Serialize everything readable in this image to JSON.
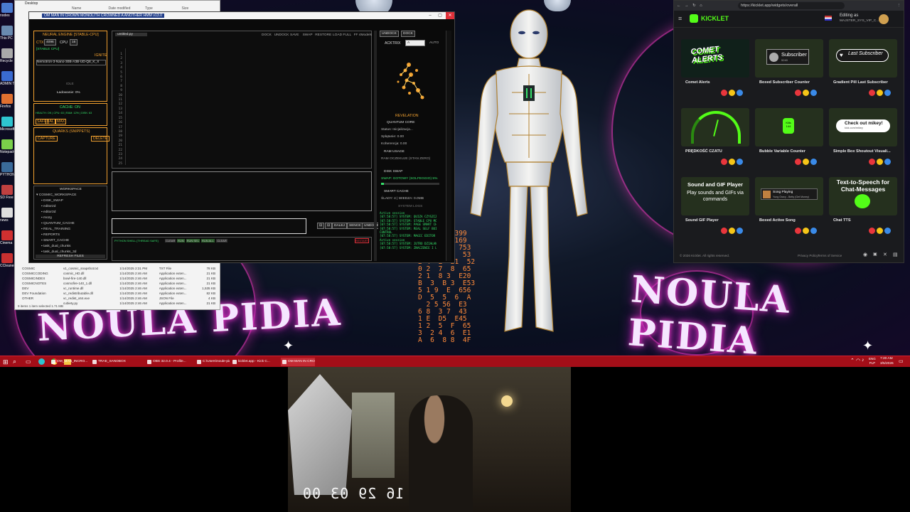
{
  "colors": {
    "accent_orange": "#f0a030",
    "terminal_green": "#35e06a",
    "taskbar": "#a30e18",
    "kicklet_green": "#53fc18"
  },
  "desktop": {
    "icons": [
      "nodes",
      "This PC",
      "Recycle",
      "ADMIN TOOLS",
      "Firefox",
      "Microsoft Edge",
      "Notepad++",
      "PYTHON",
      "SD Free",
      "news",
      "Cinema",
      "CCleaner"
    ],
    "wallpaper_text_left": "NOULA PIDIA",
    "wallpaper_text_right": "NOULA PIDIA",
    "hex_columns": [
      "4f6B7",
      "0L5 2",
      "6 5 9",
      "13 C20",
      "0A3B 8",
      "E5 93",
      "G2 7",
      "8 E99 4",
      "F1 A30",
      "3 4B 2",
      "5E8 69",
      "20 E1 4",
      "89 D5 8",
      "6A9 0 30",
      "E67 9 2",
      "15C 43"
    ],
    "hex_lines": [
      "658 B  82399",
      "E18 A  38169",
      "3 T  7 E  753",
      "7 3  B  3  53",
      "2 4  E  21  52",
      "0 2  7  8  65",
      "2 1  8 3  E20",
      "B  3  B 3  E53",
      "5 1 9  E  656",
      "D  5  5  6  A",
      "  2 5 56  E3",
      "6 8  3 7  43",
      "1 E  D5  E45",
      "1 2  5  F  65",
      "3  2 4  6  E1",
      "A  6  8 8  4F"
    ]
  },
  "explorer": {
    "title": "Desktop",
    "columns": [
      "Name",
      "Date modified",
      "Type",
      "Size"
    ],
    "tree": [
      "COSMIC",
      "COSMICCODING",
      "COSMICINDEX",
      "COSMICNOTES",
      "DEV",
      "DEV Foundation",
      "OTHER"
    ],
    "files": [
      {
        "name": "v1_cosmic_snapshot.txt",
        "date": "1/14/2025 2:31 PM",
        "type": "TXT File",
        "size": "78 KB"
      },
      {
        "name": "cosmic_HD.dll",
        "date": "1/14/2025 2:46 AM",
        "type": "Application exten...",
        "size": "21 KB"
      },
      {
        "name": "bowl-fire-140.dll",
        "date": "1/14/2025 2:46 AM",
        "type": "Application exten...",
        "size": "21 KB"
      },
      {
        "name": "cosmofire-140_1.dll",
        "date": "1/14/2025 2:46 AM",
        "type": "Application exten...",
        "size": "21 KB"
      },
      {
        "name": "vc_runtime.dll",
        "date": "1/14/2025 2:46 AM",
        "type": "Application exten...",
        "size": "1,535 KB"
      },
      {
        "name": "vc_redistributable.dll",
        "date": "1/14/2025 2:46 AM",
        "type": "Application exten...",
        "size": "82 KB"
      },
      {
        "name": "vc_redist_x64.exe",
        "date": "1/14/2025 2:46 AM",
        "type": "JSON File",
        "size": "4 KB"
      },
      {
        "name": "cubiety.py",
        "date": "1/14/2025 2:46 AM",
        "type": "Application exten...",
        "size": "21 KB"
      }
    ],
    "status": "9 items   1 item selected  1.71 MB"
  },
  "app": {
    "title": "OM MAN IN CROWN MONOLITH CROWNED A ANOTHER HMM v13.0",
    "left": {
      "header": "NEURAL ENGINE [STABLE-CPU]",
      "ctx_label": "CTX:",
      "ctx_value": "4096",
      "cpu_label": "CPU",
      "cpu_value": "16",
      "stable": "[STABLE CPU]",
      "ignite": "IGNITE",
      "model": "Nemotron-3-Nano-30B-A3B-UD-Q8_K_X",
      "idle": "IDLE",
      "loading": "Ładowanie: 0%",
      "cache": "CACHE: ON",
      "cache_info": "HEALTH: OK | CPU: 63 | RAM: 12% | DISK: 63",
      "cache_buttons": [
        "SAFE",
        "BAL",
        "MAX"
      ],
      "quarks": "QUARKS (SNIPPETS)",
      "capture": "CAPTURE",
      "delete": "DELETE",
      "workspace": "WORKSPACE",
      "tree": [
        "COSMIC_WORKSPACE",
        "DISK_SWAP",
        "editor2d",
        "editor3d",
        "mozg",
        "QUANTUM_CACHE",
        "REAL_TRAINING",
        "REPORTS",
        "SMART_CACHE",
        "task_dual_chunks",
        "task_dual_chunks_3d"
      ],
      "refresh": "REFRESH FILES"
    },
    "editor": {
      "tab": "untitled.py",
      "toolbar": [
        "DOCK",
        "UNDOCK",
        "SAVE",
        "SWAP",
        "RESTORE",
        "LOAD FULL",
        "FF 4Models"
      ],
      "line_numbers": [
        "1",
        "2",
        "3",
        "4",
        "5",
        "6",
        "7",
        "8",
        "9",
        "10",
        "11",
        "12",
        "13",
        "14",
        "15",
        "16",
        "17",
        "18",
        "19",
        "20",
        "21",
        "22",
        "23",
        "24",
        "25"
      ],
      "controls": [
        "DALEJ",
        "SENCE",
        "UNDOCK"
      ],
      "console_label": "PYTHON SHELL [THREAD SAFE]",
      "console_buttons": [
        "CLEAR",
        "RUN",
        "RUN SEL",
        "RUN ALL",
        "CLEAR"
      ],
      "restart": "RESTART"
    },
    "right": {
      "undock": "UNDOCK",
      "dock": "DOCK",
      "activate": "ACKTRIX",
      "select": "A",
      "auto": "AUTO",
      "revelation": "REVELATION",
      "quantum_core": "QUANTUM CORE",
      "status": "Status: Inicjalizacja...",
      "spl": "Splątanie: 0.00",
      "koh": "Koherencja: 0.00",
      "ram_usage": "RAM USAGE",
      "ram_info": "RAM OCZEKUJE (STAN ZERO)",
      "disk_swap": "DISK SWAP",
      "swap_info": "SWAP: GOTOWY (SOLFEGGIO) 5%",
      "smart_cache": "SMART CACHE",
      "slady": "ŚLADY: 4 | WIEDZA: 0.0MB",
      "system_logs": "SYSTEM LOGS",
      "logs": [
        "Active session",
        "[07:58:57] SYSTEM: QUIZA CZYSZCZENIE...",
        "[07:58:57] SYSTEM: STABLE CPU MODE...",
        "[07:58:57] SYSTEM: PAGE SMART CHUNK...",
        "[07:58:57] SYSTEM: REAL SELF BUILDER...",
        "CONTROL",
        "[07:58:57] SYSTEM: MAGIC EDITOR B...",
        "Active session",
        "[07:58:57] SYSTEM: JUTRO DZIAŁANIE",
        "[07:58:57] SYSTEM: ZNACZENIE I LOGS TO"
      ]
    }
  },
  "browser": {
    "url": "https://kicklet.app/widgets/overall",
    "logo": "KICKLET",
    "editing_label": "Editing as",
    "editing_user": "MAJSTER_SYS_VIP_C...",
    "widgets": [
      {
        "name": "Comet Alerts",
        "preview": "COMET ALERTS"
      },
      {
        "name": "Boxed Subscriber Counter",
        "preview": "Subscriber"
      },
      {
        "name": "Gradient Pill Last Subscriber",
        "preview": "Last Subscriber"
      },
      {
        "name": "PRĘDKOŚĆ CZATU",
        "preview": ""
      },
      {
        "name": "Bubble Variable Counter",
        "preview": "Kills"
      },
      {
        "name": "Simple Box Shoutout Visuali...",
        "preview": "Check out mikey!"
      },
      {
        "name": "Sound GIF Player",
        "preview": "Sound and GIF Player"
      },
      {
        "name": "Boxed Active Song",
        "preview": "Song Playing"
      },
      {
        "name": "Chat TTS",
        "preview": "Text-to-Speech for Chat-Messages"
      }
    ],
    "widget_sub": {
      "subscriber_count": "5240",
      "kills_count": "144",
      "check_sub": "kick.com/mikey",
      "gif_sub": "Play sounds and GIFs via commands",
      "song_sub": "Yung Gravy - Betty (Get Money)"
    },
    "footer_left": "© 2026 Kicklet. All rights reserved.",
    "footer_links": [
      "Privacy Policy",
      "Terms of Service"
    ]
  },
  "taskbar": {
    "items": [
      "OM_MAN_INCRO...",
      "TRAE_SANDBOX",
      "OBS 32.0.4 - Profile...",
      "C:\\Users\\noule-pid...",
      "kicklet.app - Kick C...",
      "OM MAN IN CRO..."
    ],
    "lang": "ENG\nPLP",
    "time": "7:20 AM",
    "date": "3/5/2026"
  },
  "webcam": {
    "timestamp": "16 29 03 00"
  }
}
